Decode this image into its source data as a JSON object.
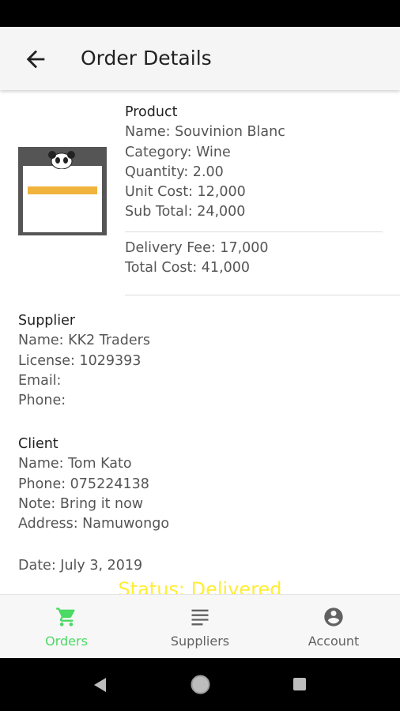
{
  "appbar": {
    "title": "Order Details",
    "back_icon": "arrow-left-icon"
  },
  "product": {
    "heading": "Product",
    "name": "Name: Souvinion Blanc",
    "category": "Category: Wine",
    "quantity": "Quantity: 2.00",
    "unit_cost": "Unit Cost: 12,000",
    "sub_total": "Sub Total: 24,000",
    "delivery_fee": "Delivery Fee: 17,000",
    "total_cost": "Total Cost: 41,000"
  },
  "supplier": {
    "heading": "Supplier",
    "name": "Name: KK2 Traders",
    "license": "License: 1029393",
    "email": "Email:",
    "phone": "Phone:"
  },
  "client": {
    "heading": "Client",
    "name": "Name: Tom Kato",
    "phone": "Phone: 075224138",
    "note": "Note: Bring it now",
    "address": "Address: Namuwongo"
  },
  "order": {
    "date": "Date: July 3, 2019",
    "status": "Status: Delivered"
  },
  "bottom_nav": {
    "items": [
      {
        "label": "Orders",
        "icon": "cart-icon",
        "active": true
      },
      {
        "label": "Suppliers",
        "icon": "list-icon",
        "active": false
      },
      {
        "label": "Account",
        "icon": "account-circle-icon",
        "active": false
      }
    ]
  },
  "colors": {
    "active": "#4cd964",
    "inactive": "#616161",
    "status": "#ffee33",
    "thumb_button": "#f0b33c"
  }
}
